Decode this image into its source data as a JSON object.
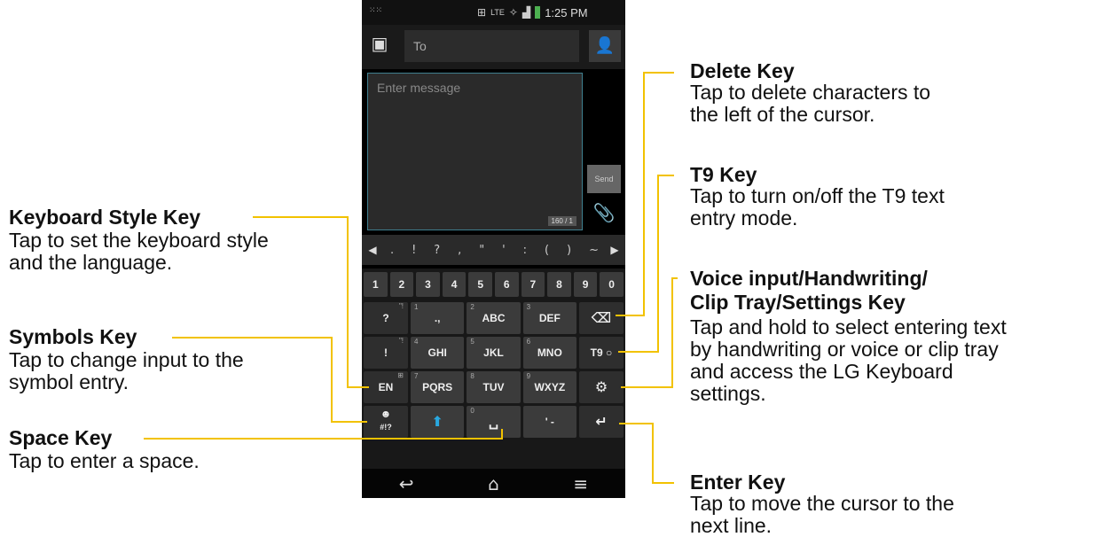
{
  "status_bar": {
    "grid_glyph": "⁙⁙",
    "lte": "LTE",
    "time": "1:25 PM"
  },
  "header": {
    "to_placeholder": "To"
  },
  "message": {
    "placeholder": "Enter message",
    "counter": "160 / 1",
    "send_label": "Send"
  },
  "symbol_strip": {
    "symbols": [
      ".",
      "!",
      "?",
      ",",
      "\"",
      "'",
      ":",
      "(",
      ")",
      "~"
    ]
  },
  "keyboard": {
    "numbers": [
      "1",
      "2",
      "3",
      "4",
      "5",
      "6",
      "7",
      "8",
      "9",
      "0"
    ],
    "row1": {
      "left": "?",
      "left_sup": "\"!",
      "k1_num": "1",
      "k1": ".,",
      "k2_num": "2",
      "k2": "ABC",
      "k3_num": "3",
      "k3": "DEF"
    },
    "row2": {
      "left": "!",
      "left_sup": "\"!",
      "k1_num": "4",
      "k1": "GHI",
      "k2_num": "5",
      "k2": "JKL",
      "k3_num": "6",
      "k3": "MNO",
      "right": "T9"
    },
    "row3": {
      "left": "EN",
      "k1_num": "7",
      "k1": "PQRS",
      "k2_num": "8",
      "k2": "TUV",
      "k3_num": "9",
      "k3": "WXYZ"
    },
    "row4": {
      "left_face": "☻",
      "left": "#!?",
      "k2_num": "0",
      "k3": "' -"
    }
  },
  "annotations": {
    "delete": {
      "title": "Delete Key",
      "desc_line1": "Tap to delete characters to",
      "desc_line2": "the left of the cursor."
    },
    "t9": {
      "title": "T9 Key",
      "desc_line1": "Tap to turn on/off the T9 text",
      "desc_line2": "entry mode."
    },
    "voice": {
      "title_line1": "Voice input/Handwriting/",
      "title_line2": "Clip Tray/Settings Key",
      "desc_line1": "Tap and hold to select entering text",
      "desc_line2": "by handwriting or voice or clip tray",
      "desc_line3": "and access the LG Keyboard",
      "desc_line4": "settings."
    },
    "enter": {
      "title": "Enter Key",
      "desc_line1": "Tap to move the cursor to the",
      "desc_line2": "next line."
    },
    "style": {
      "title": "Keyboard Style Key",
      "desc_line1": "Tap to set the keyboard style",
      "desc_line2": "and the  language."
    },
    "symbols": {
      "title": "Symbols Key",
      "desc_line1": "Tap to change input to the",
      "desc_line2": "symbol entry."
    },
    "space": {
      "title": "Space Key",
      "desc_line1": "Tap to enter a space."
    }
  },
  "icons": {
    "contact": "contact-card-icon",
    "person": "person-icon",
    "paperclip": "paperclip-icon",
    "delete": "backspace-icon",
    "settings": "gear-icon",
    "shift": "shift-arrow-icon",
    "space": "space-bar-icon",
    "enter": "enter-return-icon",
    "back": "back-nav-icon",
    "home": "home-nav-icon",
    "menu": "menu-nav-icon"
  },
  "colors": {
    "leader_lines": "#f2c200",
    "shift_arrow": "#29a8e0",
    "message_border": "#3f7f8f",
    "battery": "#4caf50"
  }
}
